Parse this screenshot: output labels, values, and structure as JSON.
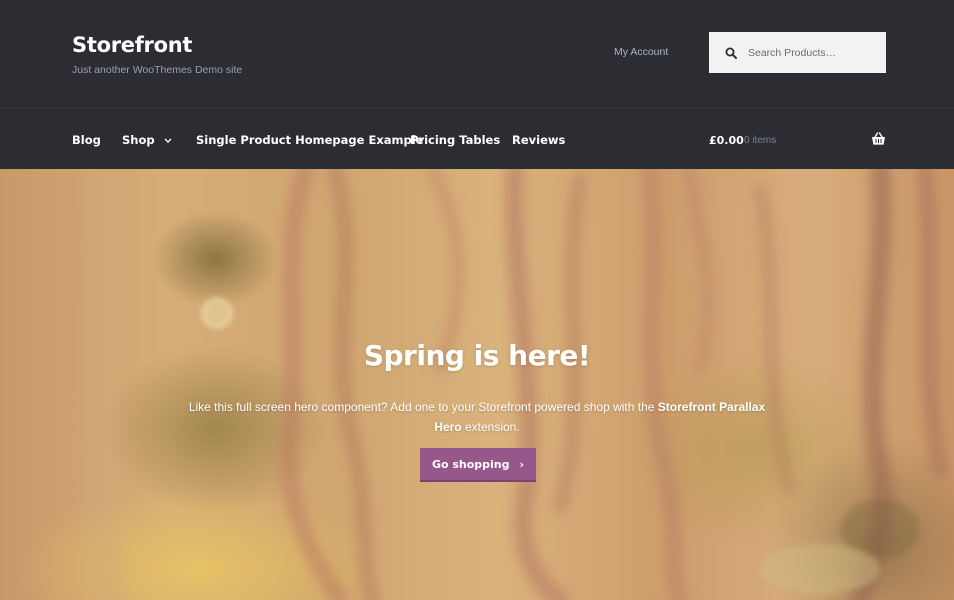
{
  "header": {
    "site_title": "Storefront",
    "site_description": "Just another WooThemes Demo site",
    "account_link": "My Account",
    "search": {
      "placeholder": "Search Products…",
      "icon": "search-icon"
    }
  },
  "nav": {
    "items": [
      {
        "label": "Blog"
      },
      {
        "label": "Shop",
        "icon": "chevron-down-icon"
      },
      {
        "label": "Single Product Homepage Example"
      },
      {
        "label": "Pricing Tables"
      },
      {
        "label": "Reviews"
      }
    ],
    "cart": {
      "amount": "£0.00",
      "count": "0 items",
      "icon": "basket-icon"
    }
  },
  "hero": {
    "title": "Spring is here!",
    "text_before": "Like this full screen hero component? Add one to your Storefront powered shop with the ",
    "text_bold": "Storefront Parallax Hero",
    "text_after": " extension.",
    "button_label": "Go shopping",
    "button_arrow": "›"
  },
  "colors": {
    "header_bg": "#2c2d33",
    "accent": "#96588a",
    "text_light": "#ffffff"
  }
}
